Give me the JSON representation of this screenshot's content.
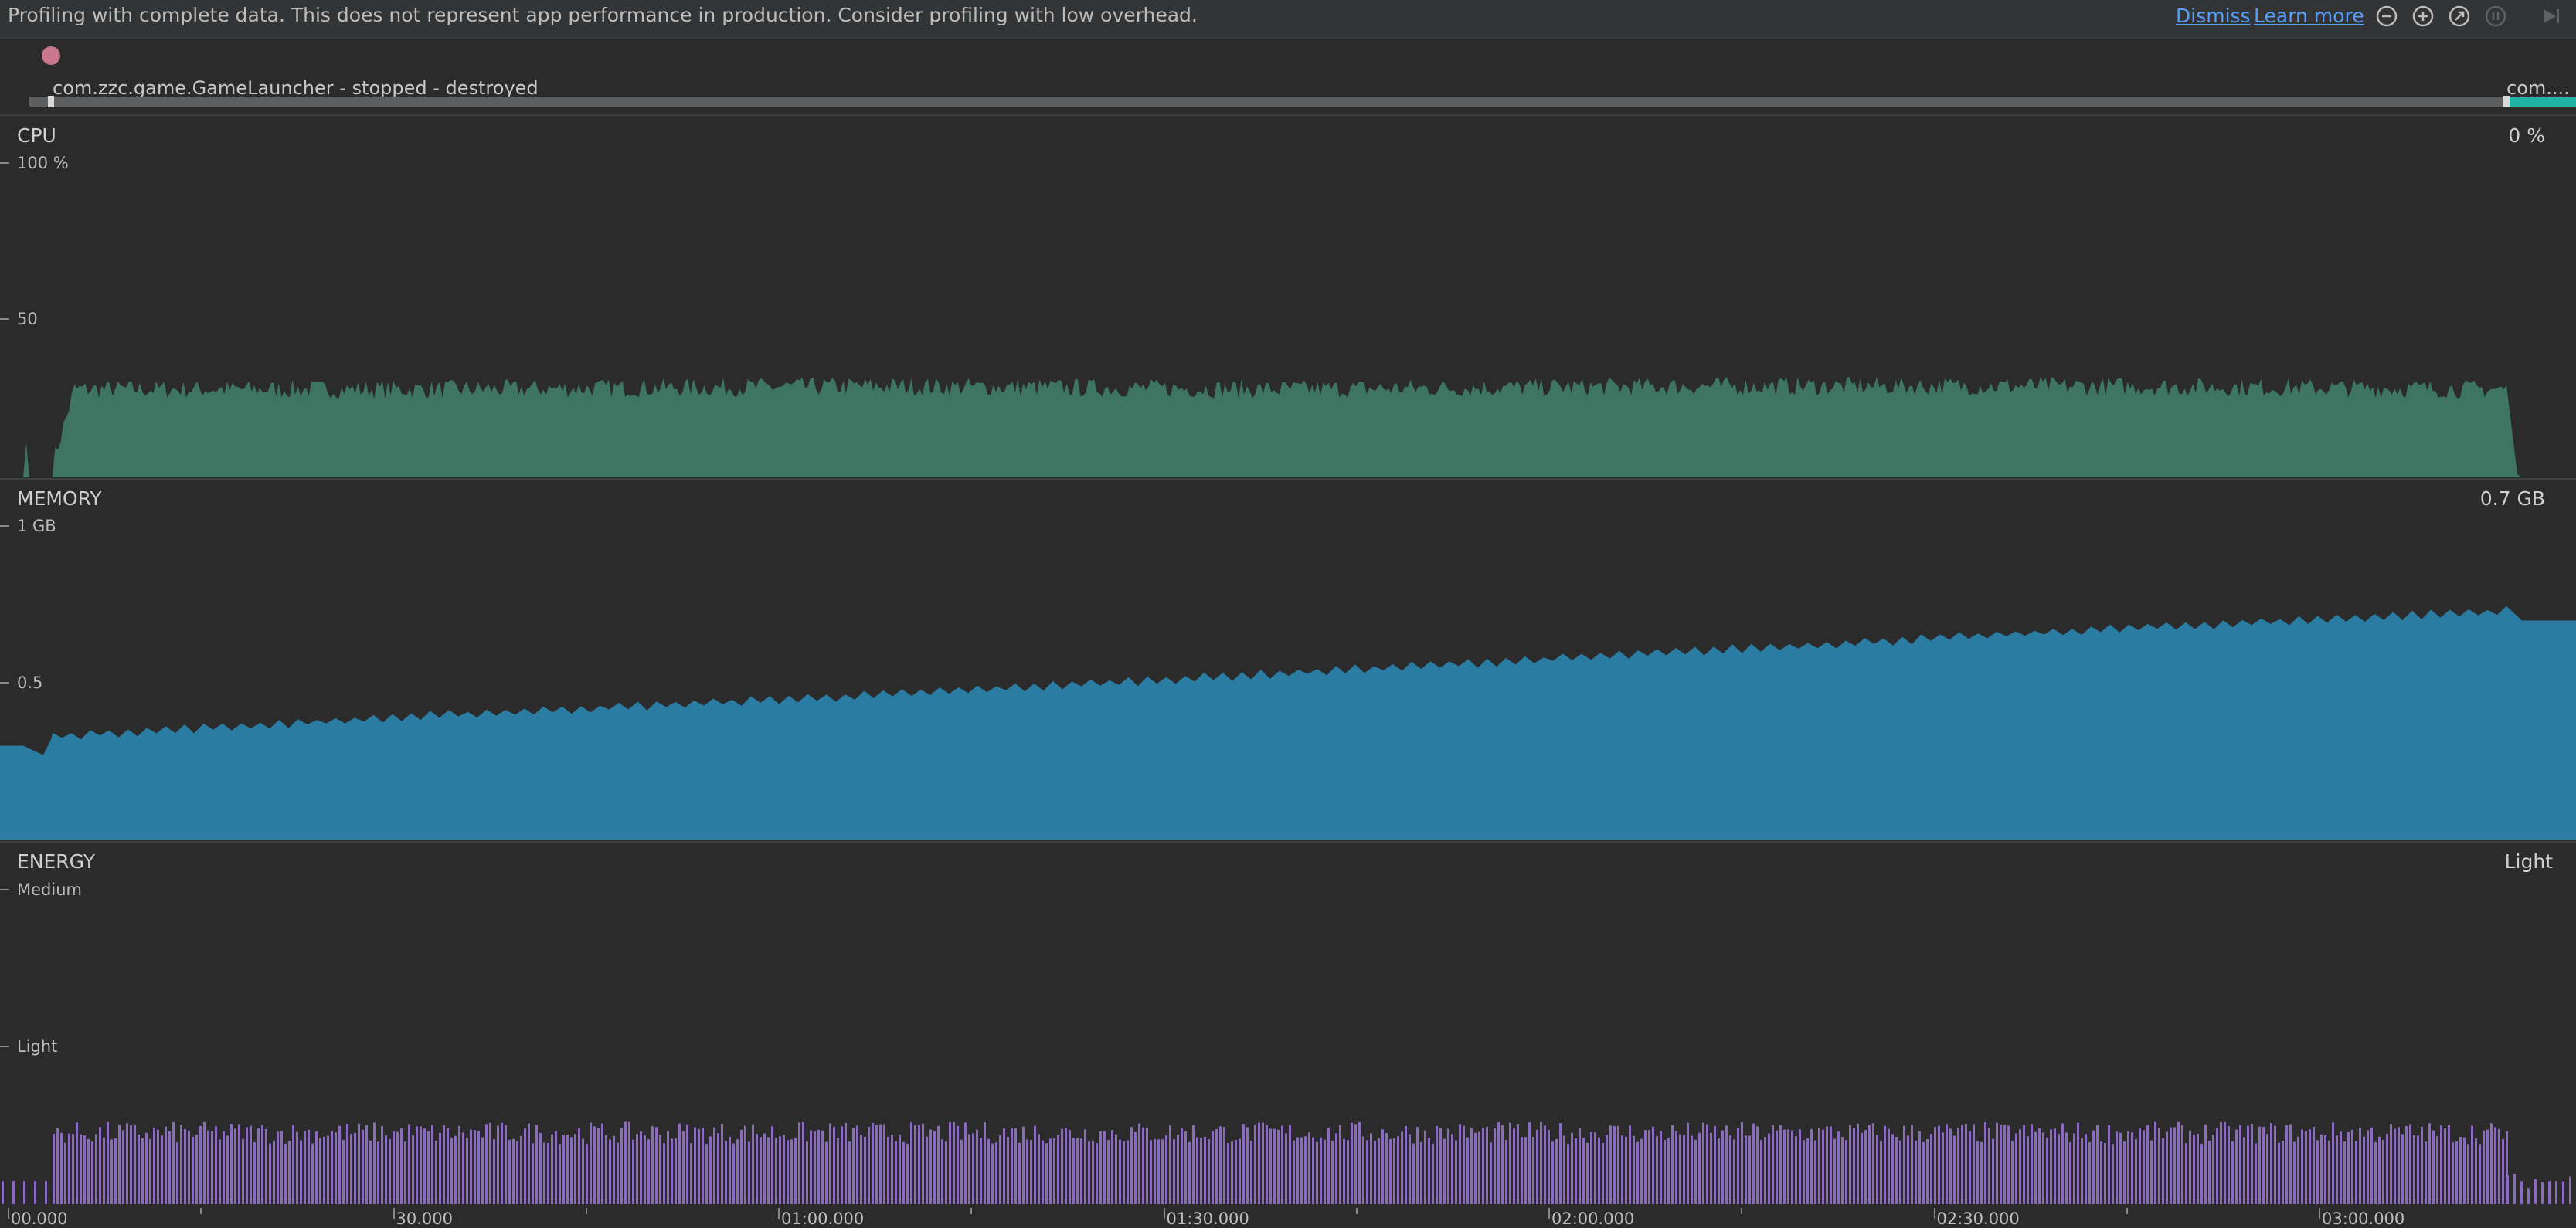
{
  "banner": {
    "message": "Profiling with complete data. This does not represent app performance in production. Consider profiling with low overhead.",
    "dismiss_label": "Dismiss",
    "learn_more_label": "Learn more",
    "toolbar_icons": [
      "zoom-out-icon",
      "zoom-in-icon",
      "reset-zoom-icon",
      "pause-icon",
      "jump-to-live-icon"
    ]
  },
  "session": {
    "label": "com.zzc.game.GameLauncher - stopped - destroyed",
    "label_right": "com....",
    "indicator_color": "#c9778f",
    "active_color": "#1fb3a3"
  },
  "cpu": {
    "title": "CPU",
    "current_value": "0 %",
    "axis_labels": [
      "100 %",
      "50"
    ],
    "color": "#3e7562"
  },
  "memory": {
    "title": "MEMORY",
    "current_value": "0.7 GB",
    "axis_labels": [
      "1 GB",
      "0.5"
    ],
    "color": "#2a7ca2"
  },
  "energy": {
    "title": "ENERGY",
    "current_value": "Light",
    "axis_labels": [
      "Medium",
      "Light"
    ],
    "color": "#8a6bbd"
  },
  "time_axis": {
    "labels": [
      "00.000",
      "30.000",
      "01:00.000",
      "01:30.000",
      "02:00.000",
      "02:30.000",
      "03:00.000"
    ]
  },
  "chart_data": [
    {
      "type": "area",
      "title": "CPU",
      "unit": "%",
      "ylim": [
        0,
        100
      ],
      "x": [
        "00.000",
        "30.000",
        "01:00.000",
        "01:30.000",
        "02:00.000",
        "02:30.000",
        "03:00.000"
      ],
      "series": [
        {
          "name": "CPU",
          "values": [
            28,
            28,
            29,
            28,
            29,
            29,
            28
          ]
        }
      ]
    },
    {
      "type": "area",
      "title": "MEMORY",
      "unit": "GB",
      "ylim": [
        0,
        1
      ],
      "x": [
        "00.000",
        "30.000",
        "01:00.000",
        "01:30.000",
        "02:00.000",
        "02:30.000",
        "03:00.000"
      ],
      "series": [
        {
          "name": "MEMORY",
          "values": [
            0.33,
            0.4,
            0.46,
            0.53,
            0.6,
            0.67,
            0.73
          ]
        }
      ]
    },
    {
      "type": "bar",
      "title": "ENERGY",
      "ylim": [
        "None",
        "Medium"
      ],
      "x": [
        "00.000",
        "30.000",
        "01:00.000",
        "01:30.000",
        "02:00.000",
        "02:30.000",
        "03:00.000"
      ],
      "series": [
        {
          "name": "ENERGY",
          "values": [
            "Light",
            "Light",
            "Light",
            "Light",
            "Light",
            "Light",
            "Light"
          ]
        }
      ]
    }
  ]
}
